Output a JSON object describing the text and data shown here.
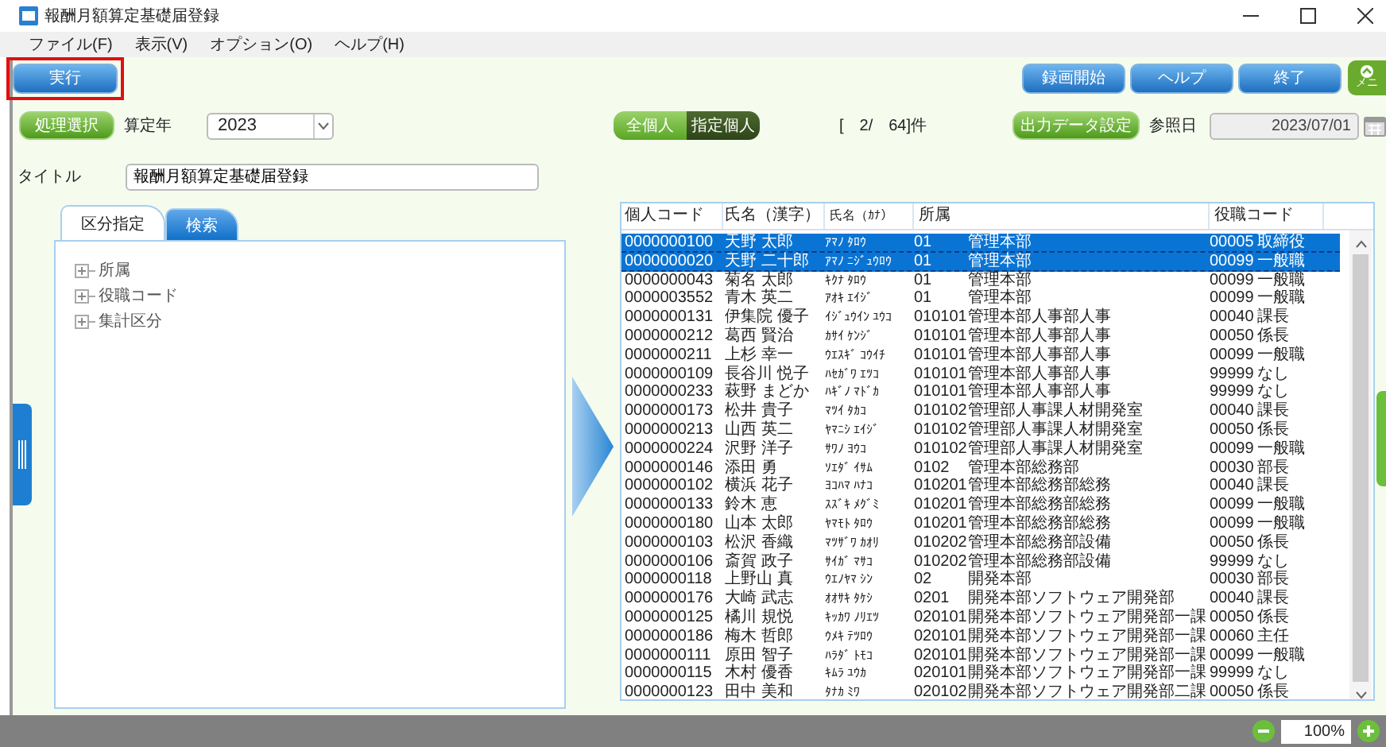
{
  "window": {
    "title": "報酬月額算定基礎届登録"
  },
  "menu": [
    "ファイル(F)",
    "表示(V)",
    "オプション(O)",
    "ヘルプ(H)"
  ],
  "toolbar": {
    "execute": {
      "label": "実行",
      "highlighted": true
    },
    "right_buttons": [
      "録画開始",
      "ヘルプ",
      "終了"
    ],
    "menu_button": "メニ"
  },
  "filter": {
    "process_button": "処理選択",
    "year_label": "算定年",
    "year_value": "2023",
    "toggle": [
      {
        "label": "全個人",
        "selected": false
      },
      {
        "label": "指定個人",
        "selected": true
      }
    ],
    "count": "[　2/　64]件",
    "output_button": "出力データ設定",
    "ref_label": "参照日",
    "ref_date": "2023/07/01"
  },
  "title_field": {
    "label": "タイトル",
    "value": "報酬月額算定基礎届登録"
  },
  "tabs": [
    {
      "label": "区分指定",
      "selected": true
    },
    {
      "label": "検索",
      "selected": false
    }
  ],
  "tree": [
    {
      "label": "所属",
      "expanded": false
    },
    {
      "label": "役職コード",
      "expanded": false
    },
    {
      "label": "集計区分",
      "expanded": false
    }
  ],
  "table": {
    "columns": [
      "個人コード",
      "氏名（漢字）",
      "氏名（ｶﾅ）",
      "所属",
      "役職コード"
    ],
    "rows": [
      {
        "code": "0000000100",
        "kanji": "天野 太郎",
        "kana": "ｱﾏﾉ ﾀﾛｳ",
        "dept_code": "01",
        "dept": "管理本部",
        "role_code": "00005",
        "role": "取締役",
        "selected": true
      },
      {
        "code": "0000000020",
        "kanji": "天野 二十郎",
        "kana": "ｱﾏﾉ ﾆｼﾞｭｳﾛｳ",
        "dept_code": "01",
        "dept": "管理本部",
        "role_code": "00099",
        "role": "一般職",
        "selected": true
      },
      {
        "code": "0000000043",
        "kanji": "菊名 太郎",
        "kana": "ｷｸﾅ ﾀﾛｳ",
        "dept_code": "01",
        "dept": "管理本部",
        "role_code": "00099",
        "role": "一般職",
        "selected": false
      },
      {
        "code": "0000003552",
        "kanji": "青木 英二",
        "kana": "ｱｵｷ ｴｲｼﾞ",
        "dept_code": "01",
        "dept": "管理本部",
        "role_code": "00099",
        "role": "一般職",
        "selected": false
      },
      {
        "code": "0000000131",
        "kanji": "伊集院 優子",
        "kana": "ｲｼﾞｭｳｲﾝ ﾕｳｺ",
        "dept_code": "010101",
        "dept": "管理本部人事部人事",
        "role_code": "00040",
        "role": "課長",
        "selected": false
      },
      {
        "code": "0000000212",
        "kanji": "葛西 賢治",
        "kana": "ｶｻｲ ｹﾝｼﾞ",
        "dept_code": "010101",
        "dept": "管理本部人事部人事",
        "role_code": "00050",
        "role": "係長",
        "selected": false
      },
      {
        "code": "0000000211",
        "kanji": "上杉 幸一",
        "kana": "ｳｴｽｷﾞ ｺｳｲﾁ",
        "dept_code": "010101",
        "dept": "管理本部人事部人事",
        "role_code": "00099",
        "role": "一般職",
        "selected": false
      },
      {
        "code": "0000000109",
        "kanji": "長谷川 悦子",
        "kana": "ﾊｾｶﾞﾜ ｴﾂｺ",
        "dept_code": "010101",
        "dept": "管理本部人事部人事",
        "role_code": "99999",
        "role": "なし",
        "selected": false
      },
      {
        "code": "0000000233",
        "kanji": "萩野 まどか",
        "kana": "ﾊｷﾞﾉ ﾏﾄﾞｶ",
        "dept_code": "010101",
        "dept": "管理本部人事部人事",
        "role_code": "99999",
        "role": "なし",
        "selected": false
      },
      {
        "code": "0000000173",
        "kanji": "松井 貴子",
        "kana": "ﾏﾂｲ ﾀｶｺ",
        "dept_code": "010102",
        "dept": "管理部人事課人材開発室",
        "role_code": "00040",
        "role": "課長",
        "selected": false
      },
      {
        "code": "0000000213",
        "kanji": "山西 英二",
        "kana": "ﾔﾏﾆｼ ｴｲｼﾞ",
        "dept_code": "010102",
        "dept": "管理部人事課人材開発室",
        "role_code": "00050",
        "role": "係長",
        "selected": false
      },
      {
        "code": "0000000224",
        "kanji": "沢野 洋子",
        "kana": "ｻﾜﾉ ﾖｳｺ",
        "dept_code": "010102",
        "dept": "管理部人事課人材開発室",
        "role_code": "00099",
        "role": "一般職",
        "selected": false
      },
      {
        "code": "0000000146",
        "kanji": "添田 勇",
        "kana": "ｿｴﾀﾞ ｲｻﾑ",
        "dept_code": "0102",
        "dept": "管理本部総務部",
        "role_code": "00030",
        "role": "部長",
        "selected": false
      },
      {
        "code": "0000000102",
        "kanji": "横浜 花子",
        "kana": "ﾖｺﾊﾏ ﾊﾅｺ",
        "dept_code": "010201",
        "dept": "管理本部総務部総務",
        "role_code": "00040",
        "role": "課長",
        "selected": false
      },
      {
        "code": "0000000133",
        "kanji": "鈴木 恵",
        "kana": "ｽｽﾞｷ ﾒｸﾞﾐ",
        "dept_code": "010201",
        "dept": "管理本部総務部総務",
        "role_code": "00099",
        "role": "一般職",
        "selected": false
      },
      {
        "code": "0000000180",
        "kanji": "山本 太郎",
        "kana": "ﾔﾏﾓﾄ ﾀﾛｳ",
        "dept_code": "010201",
        "dept": "管理本部総務部総務",
        "role_code": "00099",
        "role": "一般職",
        "selected": false
      },
      {
        "code": "0000000103",
        "kanji": "松沢 香織",
        "kana": "ﾏﾂｻﾞﾜ ｶｵﾘ",
        "dept_code": "010202",
        "dept": "管理本部総務部設備",
        "role_code": "00050",
        "role": "係長",
        "selected": false
      },
      {
        "code": "0000000106",
        "kanji": "斎賀 政子",
        "kana": "ｻｲｶﾞ ﾏｻｺ",
        "dept_code": "010202",
        "dept": "管理本部総務部設備",
        "role_code": "99999",
        "role": "なし",
        "selected": false
      },
      {
        "code": "0000000118",
        "kanji": "上野山 真",
        "kana": "ｳｴﾉﾔﾏ ｼﾝ",
        "dept_code": "02",
        "dept": "開発本部",
        "role_code": "00030",
        "role": "部長",
        "selected": false
      },
      {
        "code": "0000000176",
        "kanji": "大崎 武志",
        "kana": "ｵｵｻｷ ﾀｹｼ",
        "dept_code": "0201",
        "dept": "開発本部ソフトウェア開発部",
        "role_code": "00040",
        "role": "課長",
        "selected": false
      },
      {
        "code": "0000000125",
        "kanji": "橘川 規悦",
        "kana": "ｷｯｶﾜ ﾉﾘｴﾂ",
        "dept_code": "020101",
        "dept": "開発本部ソフトウェア開発部一課",
        "role_code": "00050",
        "role": "係長",
        "selected": false
      },
      {
        "code": "0000000186",
        "kanji": "梅木 哲郎",
        "kana": "ｳﾒｷ ﾃﾂﾛｳ",
        "dept_code": "020101",
        "dept": "開発本部ソフトウェア開発部一課",
        "role_code": "00060",
        "role": "主任",
        "selected": false
      },
      {
        "code": "0000000111",
        "kanji": "原田 智子",
        "kana": "ﾊﾗﾀﾞ ﾄﾓｺ",
        "dept_code": "020101",
        "dept": "開発本部ソフトウェア開発部一課",
        "role_code": "00099",
        "role": "一般職",
        "selected": false
      },
      {
        "code": "0000000115",
        "kanji": "木村 優香",
        "kana": "ｷﾑﾗ ﾕｳｶ",
        "dept_code": "020101",
        "dept": "開発本部ソフトウェア開発部一課",
        "role_code": "99999",
        "role": "なし",
        "selected": false
      },
      {
        "code": "0000000123",
        "kanji": "田中 美和",
        "kana": "ﾀﾅｶ ﾐﾜ",
        "dept_code": "020102",
        "dept": "開発本部ソフトウェア開発部二課",
        "role_code": "00050",
        "role": "係長",
        "selected": false
      }
    ]
  },
  "status_bar": {
    "zoom": "100%"
  }
}
